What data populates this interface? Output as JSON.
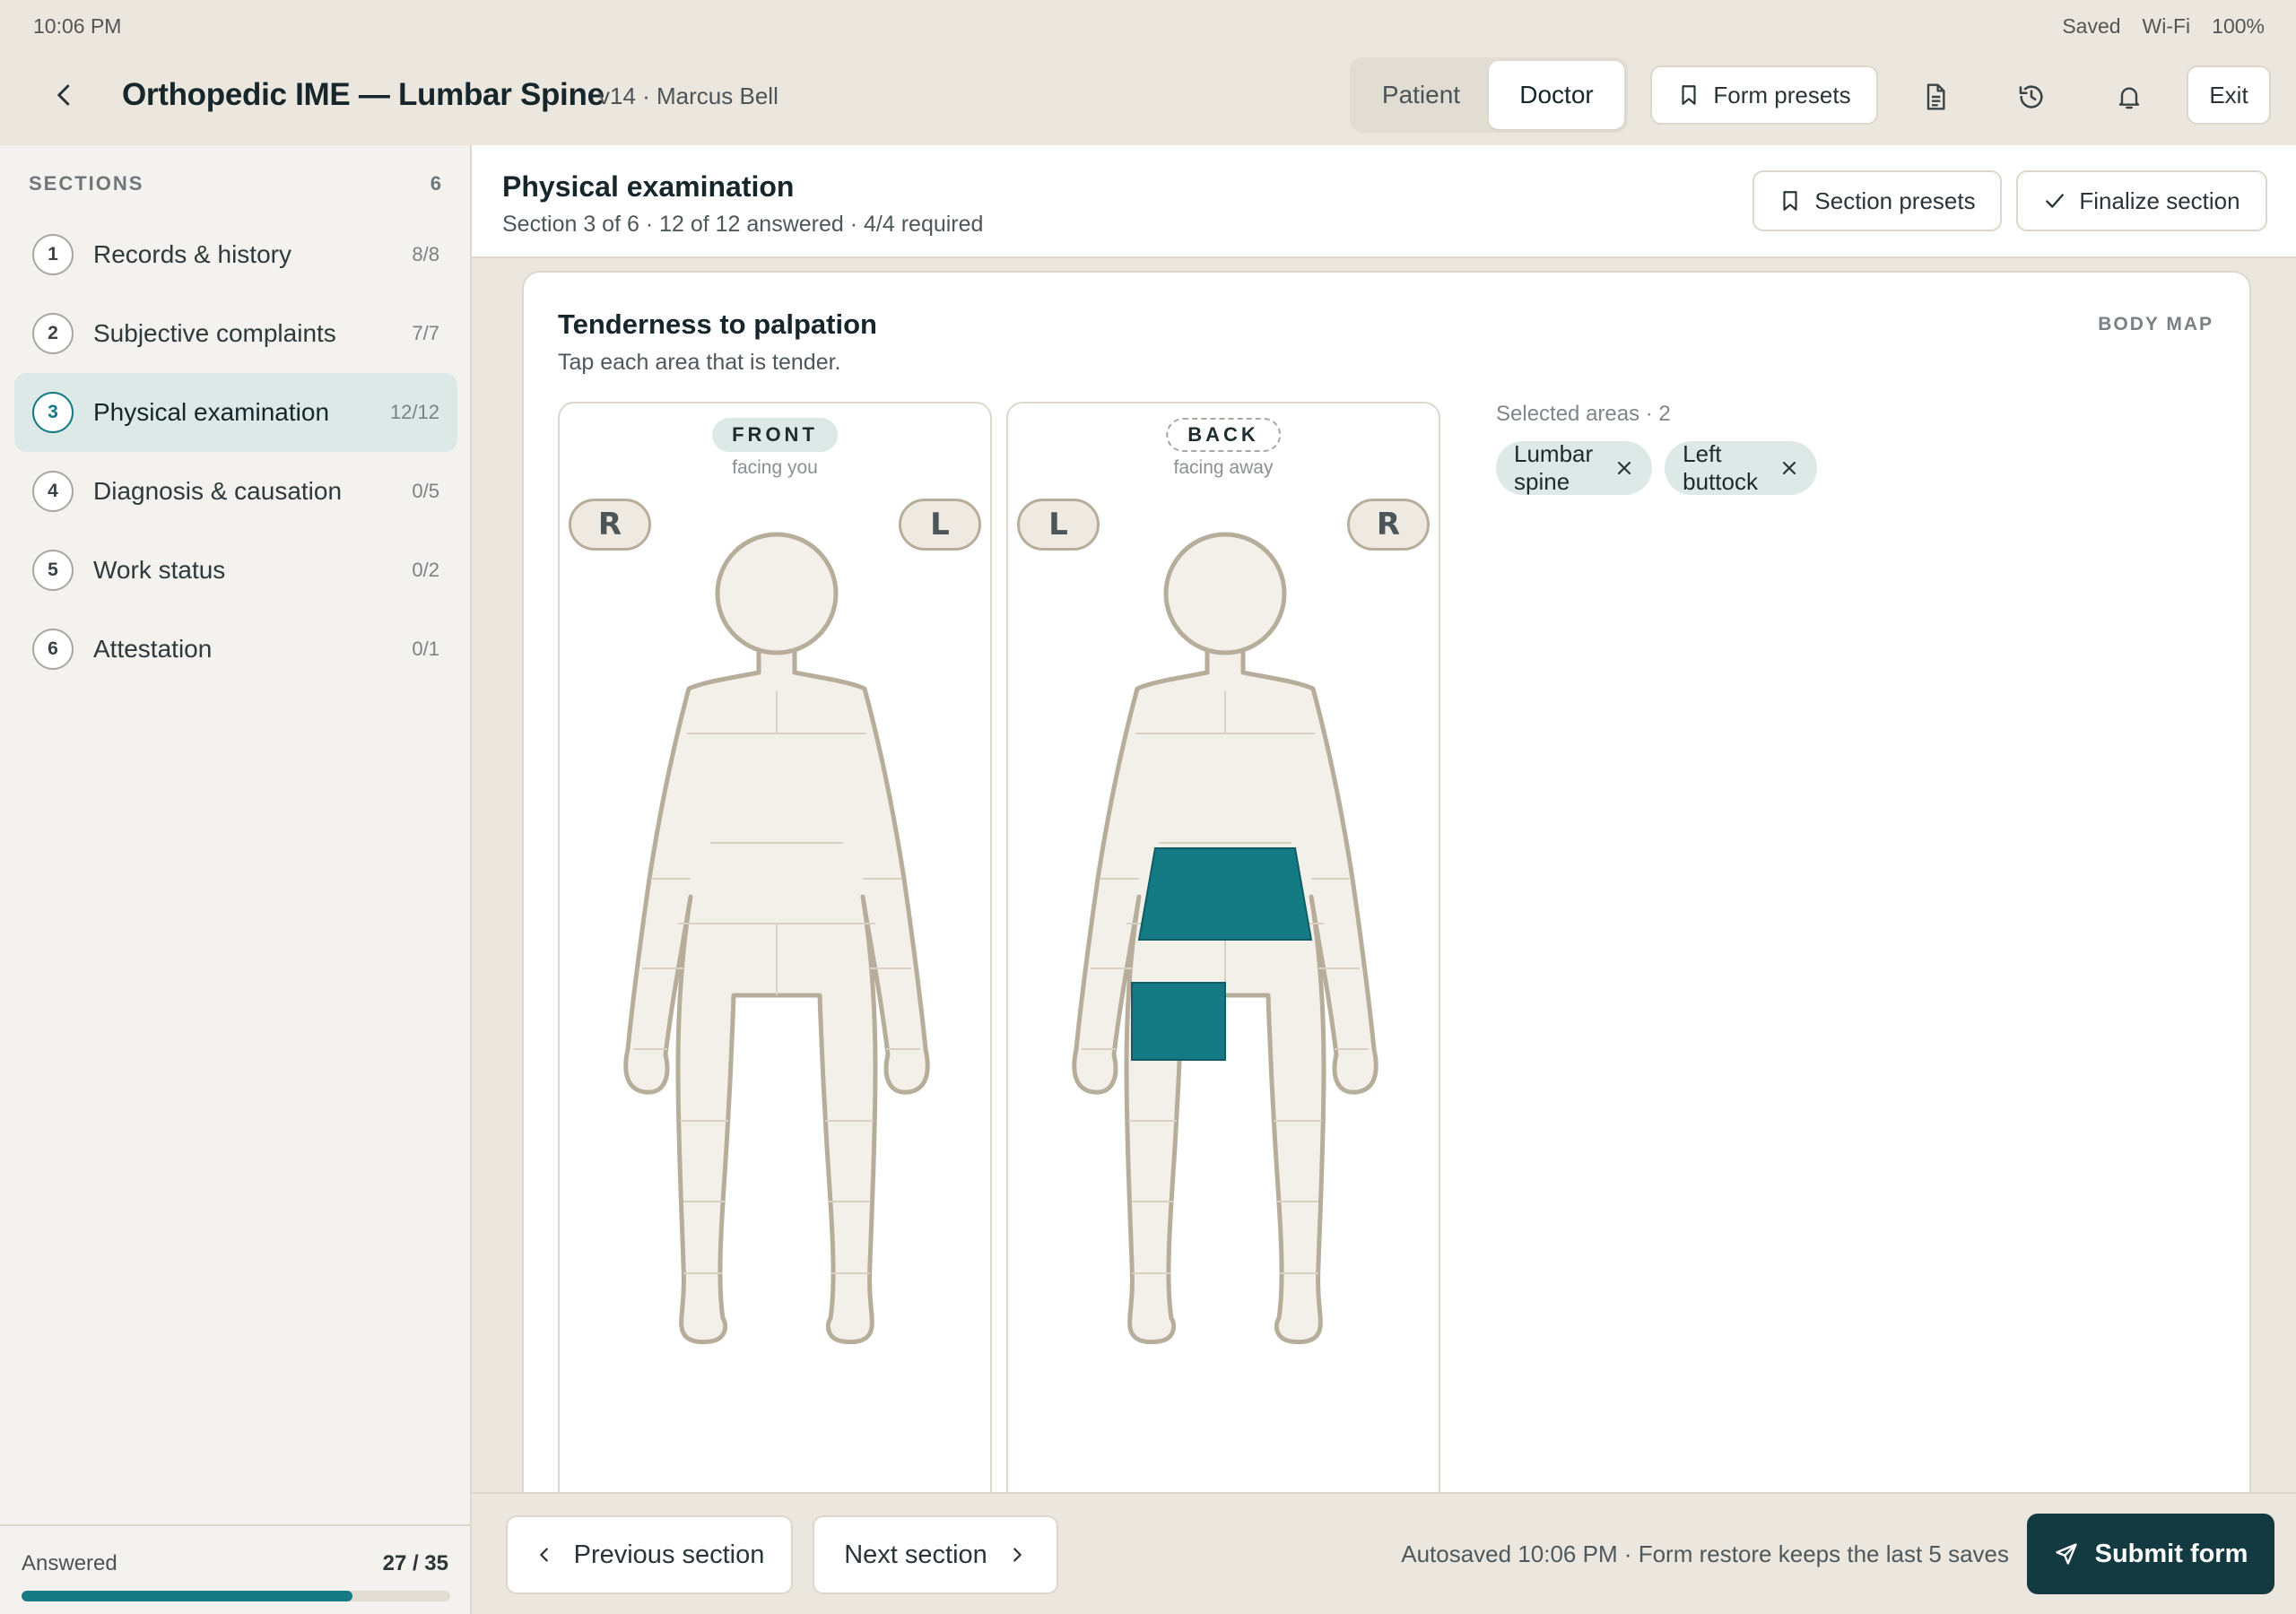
{
  "status_bar": {
    "time": "10:06 PM",
    "saved": "Saved",
    "wifi": "Wi-Fi",
    "battery": "100%"
  },
  "header": {
    "title": "Orthopedic IME — Lumbar Spine",
    "meta": "v14 · Marcus Bell",
    "view_toggle": {
      "options": [
        "Patient",
        "Doctor"
      ],
      "selected": "Doctor"
    },
    "form_presets_label": "Form presets",
    "exit_label": "Exit",
    "icons": [
      "back-chevron-icon",
      "document-icon",
      "history-icon",
      "bell-icon",
      "bookmark-icon"
    ]
  },
  "sidebar": {
    "heading": "SECTIONS",
    "count": "6",
    "items": [
      {
        "num": "1",
        "label": "Records & history",
        "count": "8/8",
        "active": false
      },
      {
        "num": "2",
        "label": "Subjective complaints",
        "count": "7/7",
        "active": false
      },
      {
        "num": "3",
        "label": "Physical examination",
        "count": "12/12",
        "active": true
      },
      {
        "num": "4",
        "label": "Diagnosis & causation",
        "count": "0/5",
        "active": false
      },
      {
        "num": "5",
        "label": "Work status",
        "count": "0/2",
        "active": false
      },
      {
        "num": "6",
        "label": "Attestation",
        "count": "0/1",
        "active": false
      }
    ],
    "answered_label": "Answered",
    "answered_value": "27 / 35",
    "answered_fraction": 0.771
  },
  "section": {
    "title": "Physical examination",
    "subtitle": "Section 3 of 6 · 12 of 12 answered · 4/4 required",
    "presets_label": "Section presets",
    "finalize_label": "Finalize section"
  },
  "card": {
    "title": "Tenderness to palpation",
    "subtitle": "Tap each area that is tender.",
    "tag": "BODY MAP",
    "front": {
      "label": "FRONT",
      "caption": "facing you",
      "left_pill": "R",
      "right_pill": "L"
    },
    "back": {
      "label": "BACK",
      "caption": "facing away",
      "left_pill": "L",
      "right_pill": "R"
    },
    "selected_label": "Selected areas · 2",
    "selected_areas": [
      "Lumbar spine",
      "Left buttock"
    ],
    "colors": {
      "selected": "#147a84",
      "figure_fill": "#f3f0ea",
      "figure_stroke": "#b7ad9b"
    }
  },
  "footer": {
    "prev_label": "Previous section",
    "next_label": "Next section",
    "autosave": "Autosaved 10:06 PM · Form restore keeps the last 5 saves",
    "submit_label": "Submit form"
  }
}
